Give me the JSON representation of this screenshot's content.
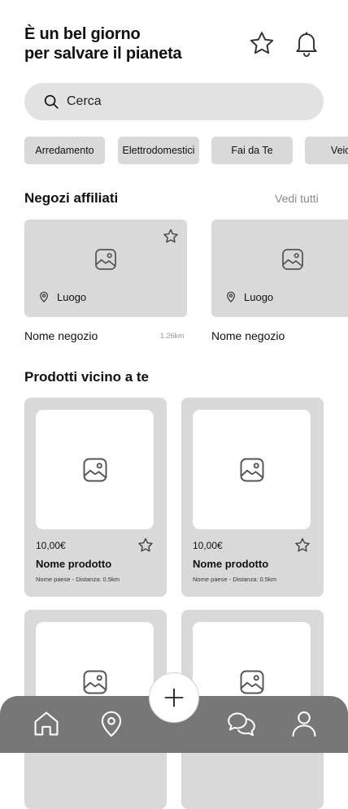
{
  "header": {
    "title_line1": "È un bel giorno",
    "title_line2": "per salvare il pianeta",
    "icons": [
      "star-icon",
      "bell-icon"
    ]
  },
  "search": {
    "placeholder": "Cerca",
    "value": ""
  },
  "categories": [
    "Arredamento",
    "Elettrodomestici",
    "Fai da Te",
    "Veicoli"
  ],
  "stores_section": {
    "title": "Negozi affiliati",
    "see_all": "Vedi tutti",
    "items": [
      {
        "location": "Luogo",
        "name": "Nome negozio",
        "distance": "1.26km"
      },
      {
        "location": "Luogo",
        "name": "Nome negozio",
        "distance": ""
      }
    ]
  },
  "products_section": {
    "title": "Prodotti vicino a te",
    "items": [
      {
        "price": "10,00€",
        "name": "Nome prodotto",
        "meta": "Nome paese - Distanza: 0.5km"
      },
      {
        "price": "10,00€",
        "name": "Nome prodotto",
        "meta": "Nome paese - Distanza: 0.5km"
      },
      {
        "price": "",
        "name": "",
        "meta": ""
      },
      {
        "price": "",
        "name": "",
        "meta": ""
      }
    ]
  },
  "navbar": {
    "items": [
      "home-icon",
      "map-pin-icon",
      "add-icon",
      "chat-icon",
      "profile-icon"
    ]
  },
  "colors": {
    "card": "#d9d9d9",
    "search": "#e2e2e2",
    "navbar": "#777777",
    "link": "#8a8a8a"
  }
}
